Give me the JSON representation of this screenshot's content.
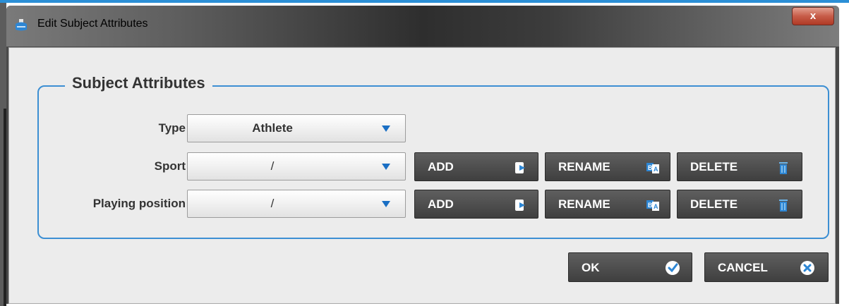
{
  "window": {
    "title": "Edit Subject Attributes",
    "close_label": "x"
  },
  "group": {
    "legend": "Subject Attributes"
  },
  "rows": {
    "type": {
      "label": "Type",
      "value": "Athlete"
    },
    "sport": {
      "label": "Sport",
      "value": "/",
      "add_label": "ADD",
      "rename_label": "RENAME",
      "delete_label": "DELETE"
    },
    "position": {
      "label": "Playing position",
      "value": "/",
      "add_label": "ADD",
      "rename_label": "RENAME",
      "delete_label": "DELETE"
    }
  },
  "footer": {
    "ok_label": "OK",
    "cancel_label": "CANCEL"
  },
  "colors": {
    "accent_blue": "#3c8fd3",
    "button_dark": "#4a4a4a",
    "dialog_bg": "#ececec",
    "close_red": "#c75c48"
  },
  "icons": [
    "app-icon",
    "dropdown-arrow-icon",
    "add-icon",
    "rename-icon",
    "delete-icon",
    "checkmark-icon",
    "cancel-x-icon"
  ]
}
